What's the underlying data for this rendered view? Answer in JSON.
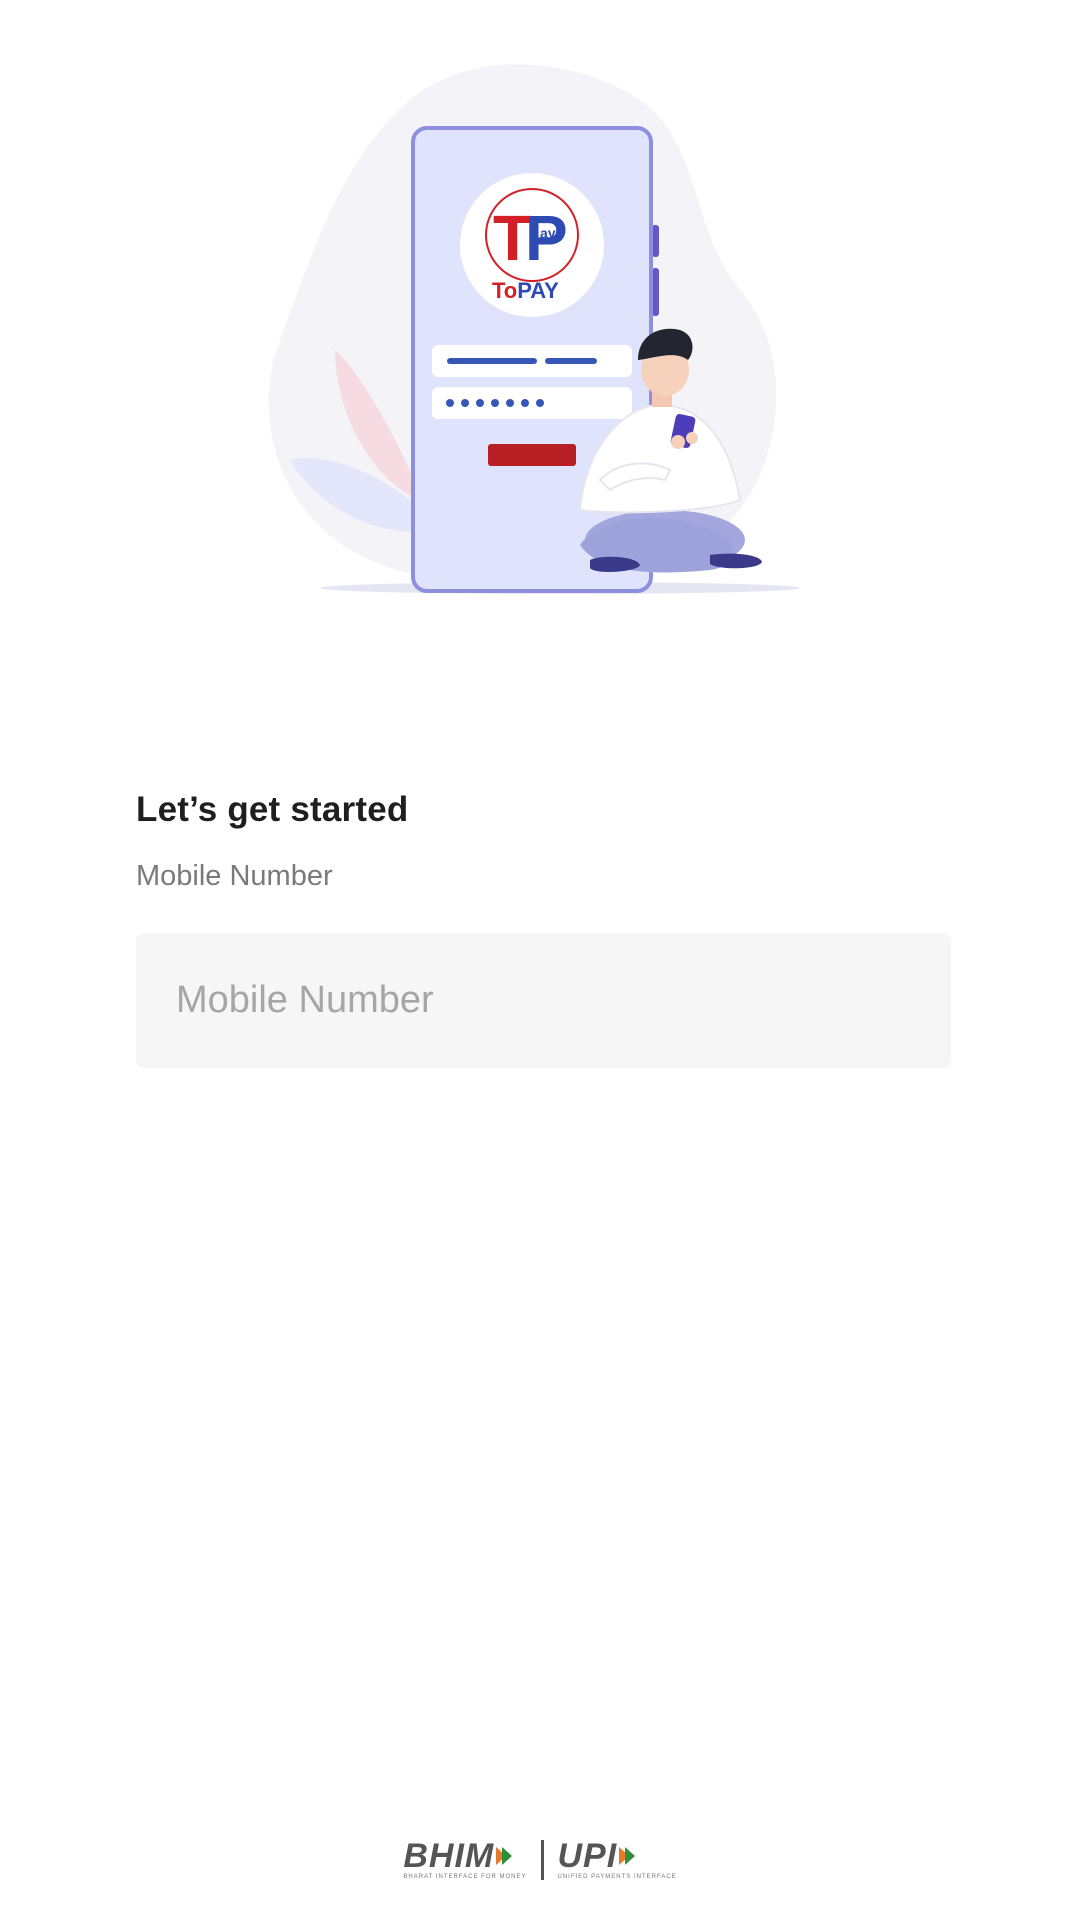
{
  "illustration": {
    "brand_logo_text": "ToPAY",
    "brand_logo_initials": "TP",
    "brand_logo_sub": "ay"
  },
  "login": {
    "title": "Let’s get started",
    "mobile_label": "Mobile Number",
    "mobile_placeholder": "Mobile Number",
    "mobile_value": ""
  },
  "footer": {
    "bhim_text": "BHIM",
    "bhim_tagline": "BHARAT INTERFACE FOR MONEY",
    "upi_text": "UPI",
    "upi_tagline": "UNIFIED PAYMENTS INTERFACE"
  },
  "colors": {
    "phone_fill": "#dfe3fb",
    "phone_border": "#8f8fe0",
    "brand_red": "#d32027",
    "brand_blue": "#2d4bb3",
    "button_red": "#b81f25"
  }
}
